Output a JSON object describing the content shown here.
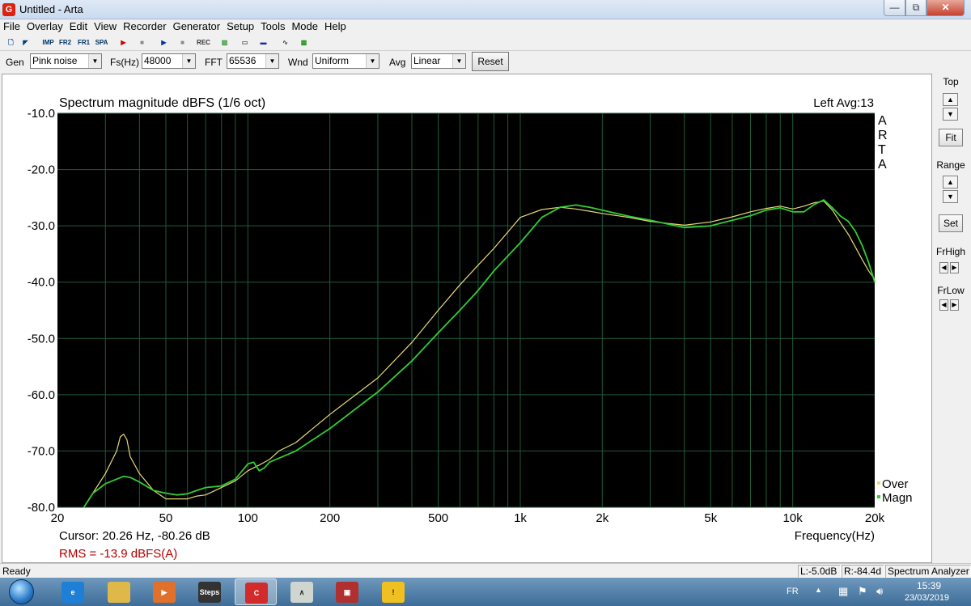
{
  "window": {
    "title": "Untitled - Arta",
    "app_icon_glyph": "G",
    "controls": {
      "minimize": "—",
      "maximize": "⧉",
      "close": "✕"
    }
  },
  "menu": [
    "File",
    "Overlay",
    "Edit",
    "View",
    "Recorder",
    "Generator",
    "Setup",
    "Tools",
    "Mode",
    "Help"
  ],
  "toolbar": {
    "buttons": [
      {
        "name": "new-icon",
        "glyph": "🗋",
        "color": "#004080"
      },
      {
        "name": "open-icon",
        "glyph": "◤",
        "color": "#004080"
      },
      {
        "name": "imp-button",
        "glyph": "IMP",
        "color": "#003366"
      },
      {
        "name": "fr2-button",
        "glyph": "FR2",
        "color": "#003366"
      },
      {
        "name": "fr1-button",
        "glyph": "FR1",
        "color": "#003366"
      },
      {
        "name": "spa-button",
        "glyph": "SPA",
        "color": "#003366"
      },
      {
        "name": "record-icon",
        "glyph": "▶",
        "color": "#cc0000"
      },
      {
        "name": "stop-icon",
        "glyph": "■",
        "color": "#888888"
      },
      {
        "name": "play-icon",
        "glyph": "▶",
        "color": "#0033aa"
      },
      {
        "name": "stop2-icon",
        "glyph": "■",
        "color": "#888888"
      },
      {
        "name": "rec-icon",
        "glyph": "REC",
        "color": "#333333"
      },
      {
        "name": "waveform-icon",
        "glyph": "▨",
        "color": "#339933"
      },
      {
        "name": "slider-icon",
        "glyph": "▭",
        "color": "#555555"
      },
      {
        "name": "bar-icon",
        "glyph": "▬",
        "color": "#2222aa"
      },
      {
        "name": "sine-icon",
        "glyph": "∿",
        "color": "#444444"
      },
      {
        "name": "monitor-icon",
        "glyph": "▩",
        "color": "#229922"
      }
    ]
  },
  "settings": {
    "gen_label": "Gen",
    "gen_value": "Pink noise",
    "fs_label": "Fs(Hz)",
    "fs_value": "48000",
    "fft_label": "FFT",
    "fft_value": "65536",
    "wnd_label": "Wnd",
    "wnd_value": "Uniform",
    "avg_label": "Avg",
    "avg_value": "Linear",
    "reset_label": "Reset"
  },
  "plot": {
    "title": "Spectrum magnitude dBFS (1/6 oct)",
    "channel_avg": "Left  Avg:13",
    "watermark": [
      "A",
      "R",
      "T",
      "A"
    ],
    "cursor_text": "Cursor:    20.26 Hz, -80.26 dB",
    "rms_text": "RMS =  -13.9 dBFS(A)",
    "legend": [
      {
        "label": "Over",
        "color": "#e8d878"
      },
      {
        "label": "Magn",
        "color": "#33cc33"
      }
    ],
    "xlabel": "Frequency(Hz)",
    "colors": {
      "background": "#000000",
      "grid": "#1f5a3a",
      "overlay": "#e8d878",
      "magnitude": "#33cc33",
      "rms_text": "#b00000"
    }
  },
  "chart_data": {
    "type": "line",
    "title": "Spectrum magnitude dBFS (1/6 oct)",
    "xlabel": "Frequency(Hz)",
    "ylabel": "",
    "x_scale": "log",
    "xlim": [
      20,
      20000
    ],
    "ylim": [
      -80,
      -10
    ],
    "x_ticks": [
      20,
      50,
      100,
      200,
      500,
      1000,
      2000,
      5000,
      10000,
      20000
    ],
    "x_tick_labels": [
      "20",
      "50",
      "100",
      "200",
      "500",
      "1k",
      "2k",
      "5k",
      "10k",
      "20k"
    ],
    "y_ticks": [
      -10,
      -20,
      -30,
      -40,
      -50,
      -60,
      -70,
      -80
    ],
    "y_tick_labels": [
      "-10.0",
      "-20.0",
      "-30.0",
      "-40.0",
      "-50.0",
      "-60.0",
      "-70.0",
      "-80.0"
    ],
    "grid": true,
    "legend_position": "bottom-right",
    "series": [
      {
        "name": "Over",
        "color": "#e8d878",
        "x": [
          25,
          30,
          33,
          34,
          35,
          36,
          37,
          40,
          45,
          50,
          55,
          60,
          65,
          70,
          80,
          90,
          100,
          110,
          120,
          130,
          150,
          200,
          300,
          400,
          500,
          600,
          700,
          800,
          1000,
          1200,
          1400,
          1600,
          1800,
          2000,
          2500,
          3000,
          4000,
          5000,
          6000,
          7000,
          8000,
          9000,
          10000,
          11000,
          12000,
          13000,
          14000,
          15000,
          16000,
          17000,
          18000,
          19000,
          20000
        ],
        "y": [
          -80,
          -74,
          -70,
          -67.5,
          -67,
          -68,
          -71,
          -74,
          -77,
          -78.5,
          -78.5,
          -78.5,
          -78,
          -77.8,
          -76.5,
          -75.3,
          -73.5,
          -72.5,
          -71.5,
          -70,
          -68.5,
          -63.5,
          -57,
          -50.7,
          -45,
          -40.5,
          -37,
          -34,
          -28.5,
          -27.1,
          -26.7,
          -27,
          -27.4,
          -27.8,
          -28.5,
          -29.2,
          -29.9,
          -29.3,
          -28.4,
          -27.5,
          -26.9,
          -26.5,
          -27,
          -26.5,
          -25.9,
          -25.6,
          -27.2,
          -29.5,
          -31.5,
          -33.8,
          -36,
          -38,
          -39.5
        ]
      },
      {
        "name": "Magn",
        "color": "#33cc33",
        "x": [
          25,
          27,
          30,
          33,
          35,
          37,
          40,
          45,
          50,
          55,
          60,
          65,
          70,
          80,
          90,
          100,
          105,
          110,
          115,
          120,
          150,
          200,
          300,
          400,
          500,
          600,
          700,
          800,
          1000,
          1200,
          1400,
          1600,
          1800,
          2000,
          2500,
          3000,
          4000,
          5000,
          6000,
          7000,
          8000,
          9000,
          10000,
          11000,
          12000,
          13000,
          14000,
          15000,
          16000,
          17000,
          18000,
          19000,
          20000
        ],
        "y": [
          -80,
          -77.5,
          -75.8,
          -75,
          -74.5,
          -74.7,
          -75.5,
          -77,
          -77.5,
          -77.8,
          -77.6,
          -77,
          -76.5,
          -76.2,
          -75,
          -72.3,
          -72,
          -73.5,
          -73,
          -72,
          -70,
          -66,
          -59.5,
          -54,
          -49,
          -45,
          -41.5,
          -38,
          -33,
          -28.5,
          -26.7,
          -26.3,
          -26.7,
          -27.2,
          -28.3,
          -29,
          -30.3,
          -30,
          -29,
          -28.2,
          -27.2,
          -26.8,
          -27.5,
          -27.5,
          -26.2,
          -25.4,
          -26.8,
          -28.3,
          -29.2,
          -31,
          -33.5,
          -36.5,
          -40
        ]
      }
    ]
  },
  "right_panel": {
    "top_label": "Top",
    "fit_label": "Fit",
    "range_label": "Range",
    "set_label": "Set",
    "frhigh_label": "FrHigh",
    "frlow_label": "FrLow",
    "up": "▲",
    "down": "▼",
    "left": "◀",
    "right": "▶"
  },
  "status": {
    "left": "Ready",
    "cell1": "L:-5.0dB",
    "cell2": "R:-84.4d",
    "cell3": "Spectrum Analyzer"
  },
  "taskbar": {
    "apps": [
      {
        "name": "taskbar-ie",
        "label": "e",
        "color": "#1e7fd6"
      },
      {
        "name": "taskbar-explorer",
        "label": "",
        "color": "#e0b84a"
      },
      {
        "name": "taskbar-media",
        "label": "▶",
        "color": "#e0702a"
      },
      {
        "name": "taskbar-steps",
        "label": "Steps",
        "color": "#333333"
      },
      {
        "name": "taskbar-arta",
        "label": "C",
        "color": "#d22b2b"
      },
      {
        "name": "taskbar-limp",
        "label": "∧",
        "color": "#cfd6cf"
      },
      {
        "name": "taskbar-recorder",
        "label": "▣",
        "color": "#b03030"
      },
      {
        "name": "taskbar-warning",
        "label": "!",
        "color": "#f0c020"
      }
    ],
    "lang": "FR",
    "time": "15:39",
    "date": "23/03/2019"
  }
}
